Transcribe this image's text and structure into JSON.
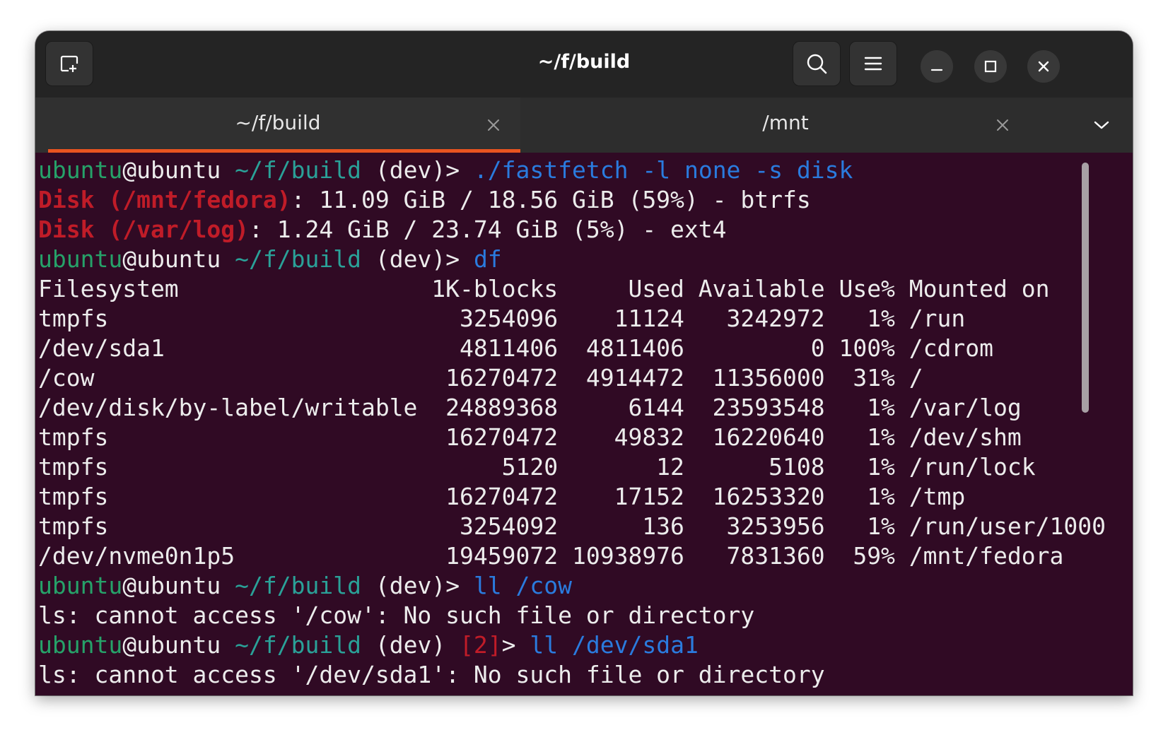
{
  "window": {
    "title": "~/f/build"
  },
  "tabs": [
    {
      "label": "~/f/build",
      "active": true
    },
    {
      "label": "/mnt",
      "active": false
    }
  ],
  "icons": {
    "new_tab": "new-tab-icon",
    "search": "search-icon",
    "menu": "hamburger-menu-icon",
    "minimize": "minimize-icon",
    "maximize": "maximize-icon",
    "close": "close-icon",
    "tab_close": "close-icon",
    "tab_dropdown": "chevron-down-icon"
  },
  "colors": {
    "terminal_bg": "#300a24",
    "prompt_user": "#26a269",
    "prompt_path": "#2aa198",
    "command": "#2a7bde",
    "error_label": "#c01c28",
    "tab_accent": "#e95420"
  },
  "terminal": {
    "lines": [
      [
        {
          "t": "ubuntu",
          "c": "green"
        },
        {
          "t": "@ubuntu ",
          "c": "white"
        },
        {
          "t": "~/f/build",
          "c": "teal"
        },
        {
          "t": " (dev)> ",
          "c": "white"
        },
        {
          "t": "./fastfetch -l none -s disk",
          "c": "blue"
        }
      ],
      [
        {
          "t": "Disk (/mnt/fedora)",
          "c": "red"
        },
        {
          "t": ": 11.09 GiB / 18.56 GiB (59%) - btrfs",
          "c": "white"
        }
      ],
      [
        {
          "t": "Disk (/var/log)",
          "c": "red"
        },
        {
          "t": ": 1.24 GiB / 23.74 GiB (5%) - ext4",
          "c": "white"
        }
      ],
      [
        {
          "t": "ubuntu",
          "c": "green"
        },
        {
          "t": "@ubuntu ",
          "c": "white"
        },
        {
          "t": "~/f/build",
          "c": "teal"
        },
        {
          "t": " (dev)> ",
          "c": "white"
        },
        {
          "t": "df",
          "c": "blue"
        }
      ],
      [
        {
          "t": "Filesystem                  1K-blocks     Used Available Use% Mounted on",
          "c": "white"
        }
      ],
      [
        {
          "t": "tmpfs                         3254096    11124   3242972   1% /run",
          "c": "white"
        }
      ],
      [
        {
          "t": "/dev/sda1                     4811406  4811406         0 100% /cdrom",
          "c": "white"
        }
      ],
      [
        {
          "t": "/cow                         16270472  4914472  11356000  31% /",
          "c": "white"
        }
      ],
      [
        {
          "t": "/dev/disk/by-label/writable  24889368     6144  23593548   1% /var/log",
          "c": "white"
        }
      ],
      [
        {
          "t": "tmpfs                        16270472    49832  16220640   1% /dev/shm",
          "c": "white"
        }
      ],
      [
        {
          "t": "tmpfs                            5120       12      5108   1% /run/lock",
          "c": "white"
        }
      ],
      [
        {
          "t": "tmpfs                        16270472    17152  16253320   1% /tmp",
          "c": "white"
        }
      ],
      [
        {
          "t": "tmpfs                         3254092      136   3253956   1% /run/user/1000",
          "c": "white"
        }
      ],
      [
        {
          "t": "/dev/nvme0n1p5               19459072 10938976   7831360  59% /mnt/fedora",
          "c": "white"
        }
      ],
      [
        {
          "t": "ubuntu",
          "c": "green"
        },
        {
          "t": "@ubuntu ",
          "c": "white"
        },
        {
          "t": "~/f/build",
          "c": "teal"
        },
        {
          "t": " (dev)> ",
          "c": "white"
        },
        {
          "t": "ll /cow",
          "c": "blue"
        }
      ],
      [
        {
          "t": "ls: cannot access '/cow': No such file or directory",
          "c": "white"
        }
      ],
      [
        {
          "t": "ubuntu",
          "c": "green"
        },
        {
          "t": "@ubuntu ",
          "c": "white"
        },
        {
          "t": "~/f/build",
          "c": "teal"
        },
        {
          "t": " (dev) ",
          "c": "white"
        },
        {
          "t": "[2]",
          "c": "red2"
        },
        {
          "t": "> ",
          "c": "white"
        },
        {
          "t": "ll /dev/sda1",
          "c": "blue"
        }
      ],
      [
        {
          "t": "ls: cannot access '/dev/sda1': No such file or directory",
          "c": "white"
        }
      ]
    ]
  }
}
